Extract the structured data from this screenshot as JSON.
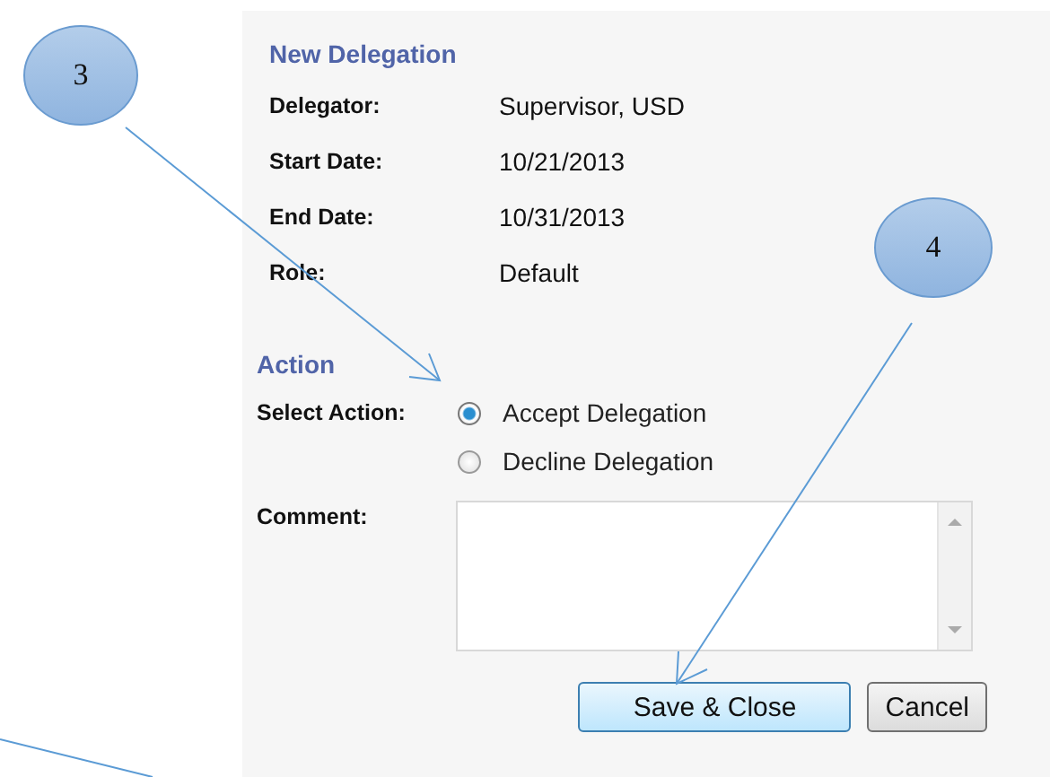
{
  "callouts": [
    {
      "label": "3"
    },
    {
      "label": "4"
    }
  ],
  "details": {
    "heading": "New Delegation",
    "fields": [
      {
        "label": "Delegator:",
        "value": "Supervisor, USD"
      },
      {
        "label": "Start Date:",
        "value": "10/21/2013"
      },
      {
        "label": "End Date:",
        "value": "10/31/2013"
      },
      {
        "label": "Role:",
        "value": "Default"
      }
    ]
  },
  "action": {
    "heading": "Action",
    "select_label": "Select Action:",
    "options": [
      {
        "label": "Accept Delegation",
        "selected": true
      },
      {
        "label": "Decline Delegation",
        "selected": false
      }
    ],
    "comment_label": "Comment:"
  },
  "buttons": [
    {
      "label": "Save & Close",
      "kind": "primary"
    },
    {
      "label": "Cancel",
      "kind": "secondary"
    }
  ]
}
